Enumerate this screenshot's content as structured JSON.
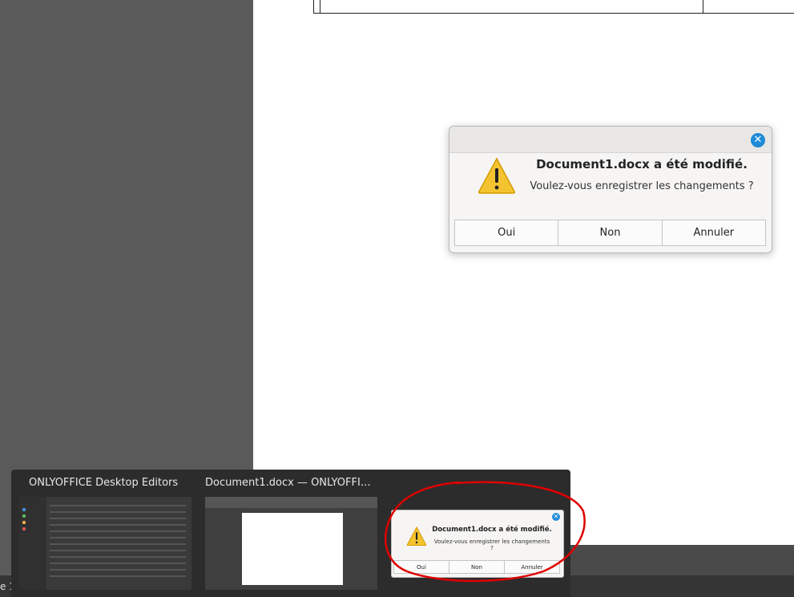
{
  "dialog": {
    "heading": "Document1.docx a été modifié.",
    "message": "Voulez-vous enregistrer les changements ?",
    "buttons": {
      "yes": "Oui",
      "no": "Non",
      "cancel": "Annuler"
    },
    "close_icon": "close-icon",
    "warning_icon": "warning-icon"
  },
  "switcher": {
    "windows": [
      {
        "title": "ONLYOFFICE Desktop Editors"
      },
      {
        "title": "Document1.docx — ONLYOFFI…"
      }
    ]
  },
  "taskbar": {
    "partial_text": "e 1"
  },
  "colors": {
    "accent": "#1f8bd6",
    "warning": "#f4c430",
    "annotation": "#e00000"
  }
}
